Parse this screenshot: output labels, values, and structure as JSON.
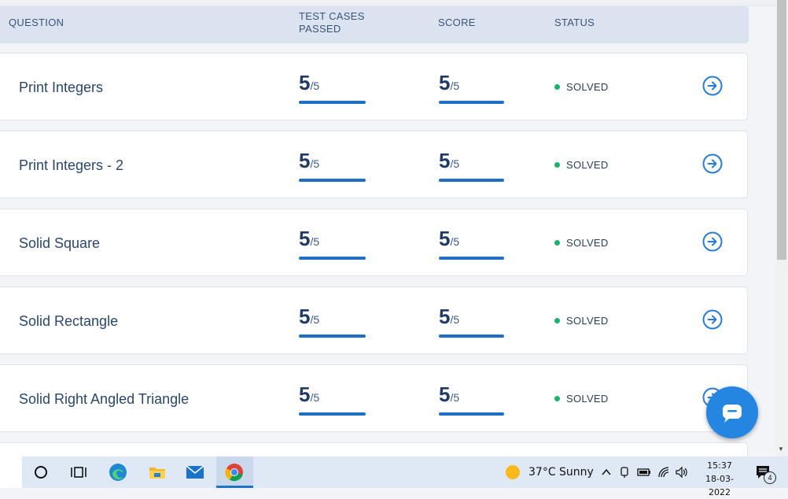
{
  "table": {
    "headers": {
      "question": "QUESTION",
      "test_cases": "TEST CASES PASSED",
      "score": "SCORE",
      "status": "STATUS"
    },
    "rows": [
      {
        "title": "Print Integers",
        "tc": "5",
        "tc_total": "/5",
        "score": "5",
        "score_total": "/5",
        "status": "SOLVED"
      },
      {
        "title": "Print Integers - 2",
        "tc": "5",
        "tc_total": "/5",
        "score": "5",
        "score_total": "/5",
        "status": "SOLVED"
      },
      {
        "title": "Solid Square",
        "tc": "5",
        "tc_total": "/5",
        "score": "5",
        "score_total": "/5",
        "status": "SOLVED"
      },
      {
        "title": "Solid Rectangle",
        "tc": "5",
        "tc_total": "/5",
        "score": "5",
        "score_total": "/5",
        "status": "SOLVED"
      },
      {
        "title": "Solid Right Angled Triangle",
        "tc": "5",
        "tc_total": "/5",
        "score": "5",
        "score_total": "/5",
        "status": "SOLVED"
      }
    ],
    "progress_fraction": 1.0
  },
  "colors": {
    "accent": "#1f6fc4",
    "solved": "#1db26b",
    "header_bg": "#dbe3f1"
  },
  "chat_widget": {
    "icon": "chat-bubble-icon"
  },
  "taskbar": {
    "apps": [
      "search-icon",
      "task-view-icon",
      "edge-icon",
      "file-explorer-icon",
      "mail-icon",
      "chrome-icon"
    ],
    "weather": "37°C  Sunny",
    "time": "15:37",
    "date": "18-03-2022",
    "notification_count": "4"
  }
}
